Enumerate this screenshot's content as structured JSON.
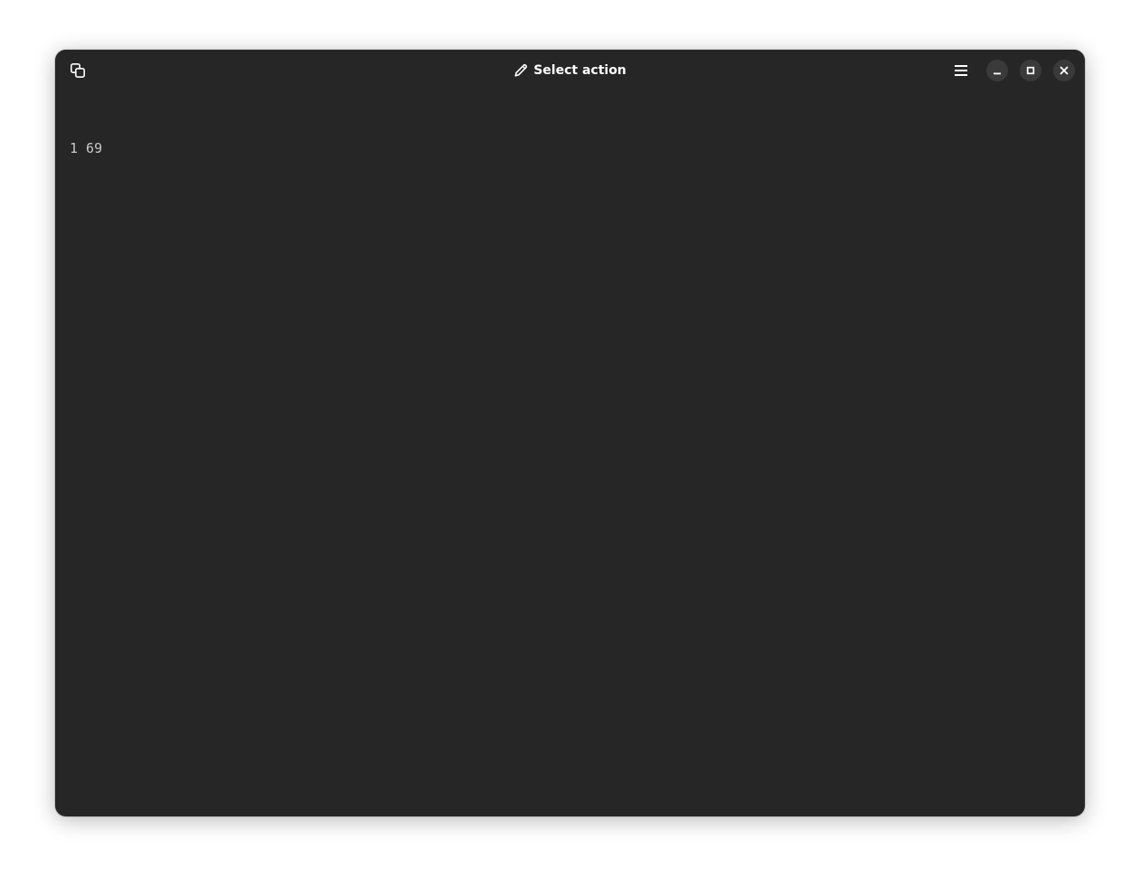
{
  "window": {
    "title": "Select action"
  },
  "terminal": {
    "lines": [
      "1 69"
    ]
  },
  "icons": {
    "copy": "copy-icon",
    "edit": "pencil-icon",
    "menu": "hamburger-menu-icon",
    "minimize": "minimize-icon",
    "maximize": "maximize-icon",
    "close": "close-icon"
  },
  "colors": {
    "window_bg": "#262626",
    "title_text": "#ffffff",
    "terminal_text": "#c8c8c8",
    "wm_button_bg": "#3a3a3a"
  }
}
